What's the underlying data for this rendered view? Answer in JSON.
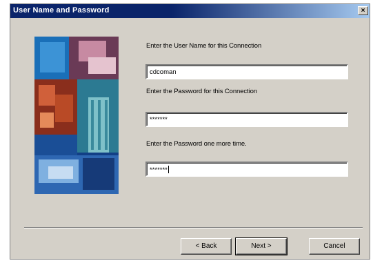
{
  "window": {
    "title": "User Name and Password",
    "close_glyph": "×"
  },
  "form": {
    "username_label": "Enter the User Name for this Connection",
    "username_value": "cdcoman",
    "password_label": "Enter the Password for this Connection",
    "password_value": "*******",
    "confirm_label": "Enter the Password one more time.",
    "confirm_value": "*******"
  },
  "buttons": {
    "back": "< Back",
    "next": "Next >",
    "cancel": "Cancel"
  },
  "colors": {
    "titlebar_start": "#0a246a",
    "titlebar_end": "#a6caf0",
    "dialog_face": "#d4d0c8"
  }
}
